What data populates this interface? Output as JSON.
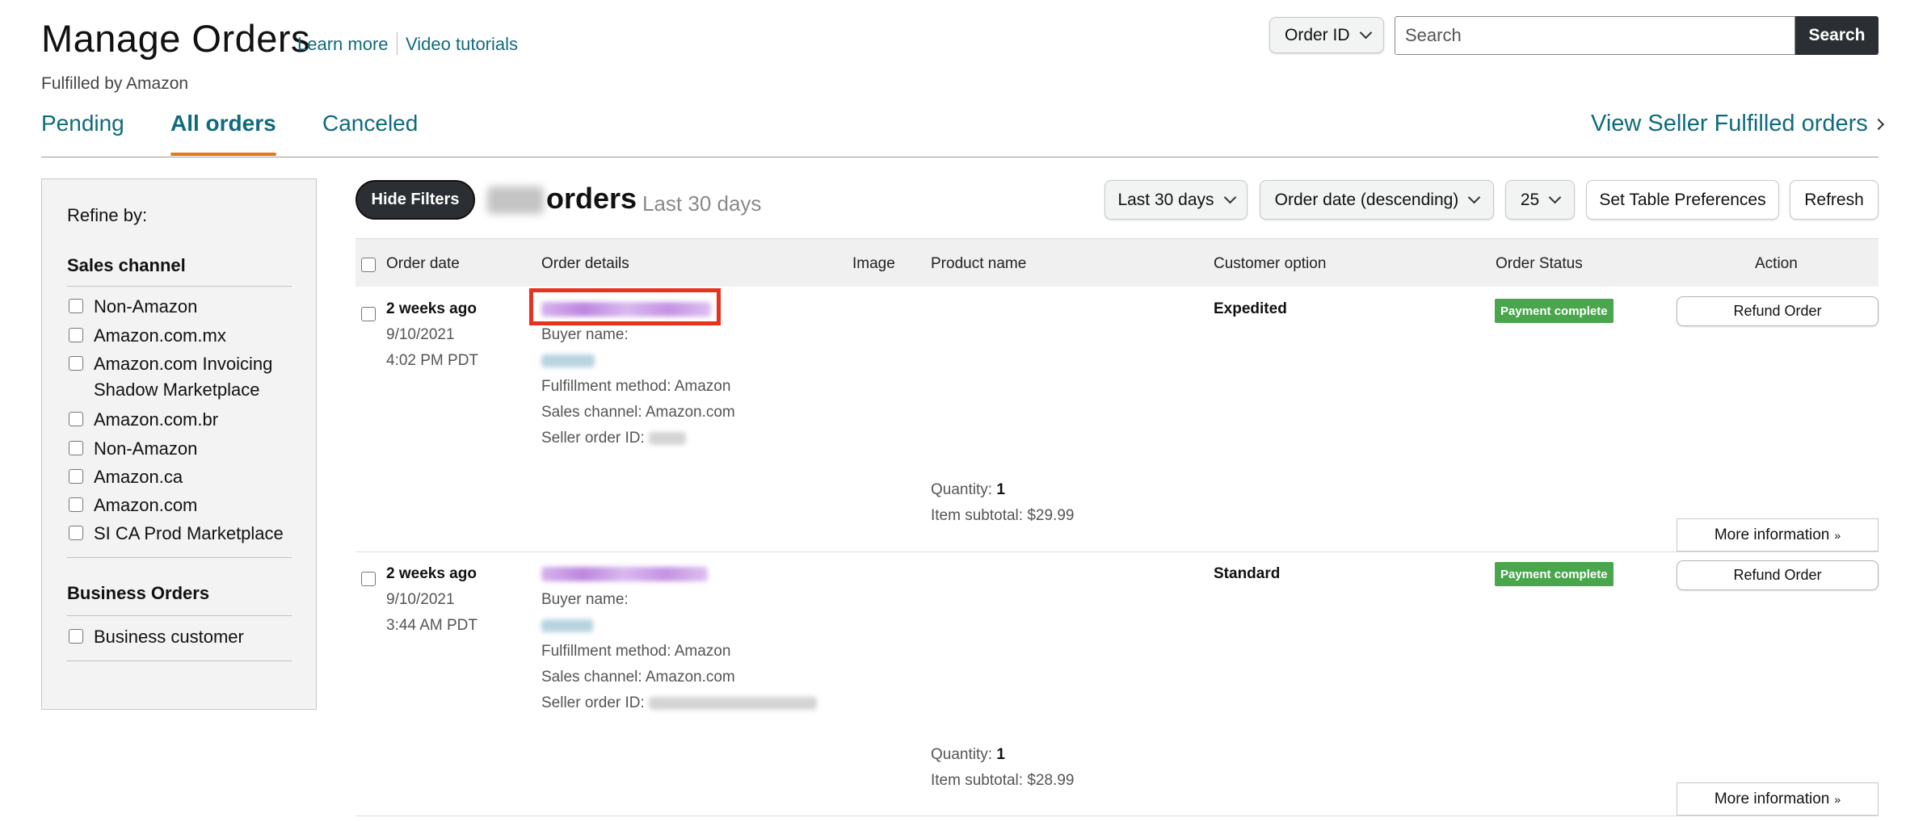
{
  "header": {
    "title": "Manage Orders",
    "learn_more": "Learn more",
    "video_tutorials": "Video tutorials",
    "subtitle": "Fulfilled by Amazon",
    "search_type": "Order ID",
    "search_placeholder": "Search",
    "search_button": "Search"
  },
  "tabs": [
    {
      "label": "Pending",
      "active": false
    },
    {
      "label": "All orders",
      "active": true
    },
    {
      "label": "Canceled",
      "active": false
    }
  ],
  "seller_link": "View Seller Fulfilled orders",
  "sidebar": {
    "refine": "Refine by:",
    "sales_channel_heading": "Sales channel",
    "sales_channels": [
      "Non-Amazon",
      "Amazon.com.mx",
      "Amazon.com Invoicing Shadow Marketplace",
      "Amazon.com.br",
      "Non-Amazon",
      "Amazon.ca",
      "Amazon.com",
      "SI CA Prod Marketplace"
    ],
    "business_heading": "Business Orders",
    "business_options": [
      "Business customer"
    ]
  },
  "toolbar": {
    "hide_filters": "Hide Filters",
    "orders_label": "orders",
    "period": "Last 30 days",
    "date_range": "Last 30 days",
    "sort": "Order date (descending)",
    "page_size": "25",
    "preferences": "Set Table Preferences",
    "refresh": "Refresh"
  },
  "table": {
    "columns": [
      "Order date",
      "Order details",
      "Image",
      "Product name",
      "Customer option",
      "Order Status",
      "Action"
    ],
    "rows": [
      {
        "relative": "2 weeks ago",
        "date": "9/10/2021",
        "time": "4:02 PM PDT",
        "buyer_label": "Buyer name:",
        "fulfillment": "Fulfillment method: Amazon",
        "channel": "Sales channel: Amazon.com",
        "seller_order_label": "Seller order ID:",
        "quantity_label": "Quantity:",
        "quantity": "1",
        "subtotal": "Item subtotal: $29.99",
        "customer_option": "Expedited",
        "status": "Payment complete",
        "refund": "Refund Order",
        "more": "More information"
      },
      {
        "relative": "2 weeks ago",
        "date": "9/10/2021",
        "time": "3:44 AM PDT",
        "buyer_label": "Buyer name:",
        "fulfillment": "Fulfillment method: Amazon",
        "channel": "Sales channel: Amazon.com",
        "seller_order_label": "Seller order ID:",
        "quantity_label": "Quantity:",
        "quantity": "1",
        "subtotal": "Item subtotal: $28.99",
        "customer_option": "Standard",
        "status": "Payment complete",
        "refund": "Refund Order",
        "more": "More information"
      }
    ]
  },
  "colors": {
    "link": "#0f6b7c",
    "tab_underline": "#e47911",
    "status_badge": "#4aa64d",
    "highlight_box": "#e8321f",
    "dark_button": "#2b2f33"
  }
}
